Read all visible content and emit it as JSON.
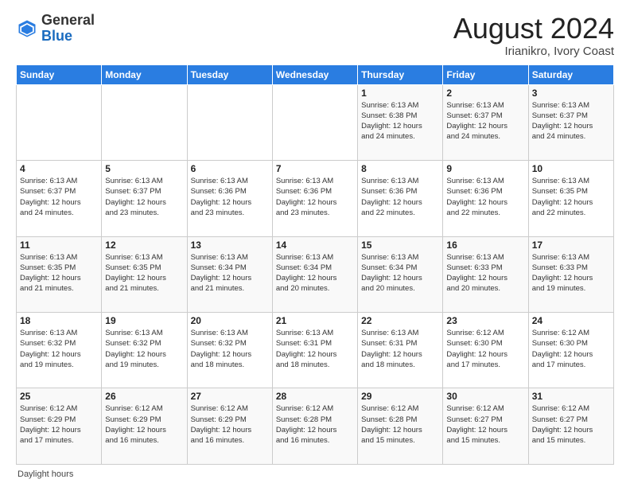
{
  "header": {
    "logo_general": "General",
    "logo_blue": "Blue",
    "main_title": "August 2024",
    "subtitle": "Irianikro, Ivory Coast"
  },
  "calendar": {
    "days_of_week": [
      "Sunday",
      "Monday",
      "Tuesday",
      "Wednesday",
      "Thursday",
      "Friday",
      "Saturday"
    ],
    "weeks": [
      [
        {
          "day": "",
          "info": ""
        },
        {
          "day": "",
          "info": ""
        },
        {
          "day": "",
          "info": ""
        },
        {
          "day": "",
          "info": ""
        },
        {
          "day": "1",
          "info": "Sunrise: 6:13 AM\nSunset: 6:38 PM\nDaylight: 12 hours\nand 24 minutes."
        },
        {
          "day": "2",
          "info": "Sunrise: 6:13 AM\nSunset: 6:37 PM\nDaylight: 12 hours\nand 24 minutes."
        },
        {
          "day": "3",
          "info": "Sunrise: 6:13 AM\nSunset: 6:37 PM\nDaylight: 12 hours\nand 24 minutes."
        }
      ],
      [
        {
          "day": "4",
          "info": "Sunrise: 6:13 AM\nSunset: 6:37 PM\nDaylight: 12 hours\nand 24 minutes."
        },
        {
          "day": "5",
          "info": "Sunrise: 6:13 AM\nSunset: 6:37 PM\nDaylight: 12 hours\nand 23 minutes."
        },
        {
          "day": "6",
          "info": "Sunrise: 6:13 AM\nSunset: 6:36 PM\nDaylight: 12 hours\nand 23 minutes."
        },
        {
          "day": "7",
          "info": "Sunrise: 6:13 AM\nSunset: 6:36 PM\nDaylight: 12 hours\nand 23 minutes."
        },
        {
          "day": "8",
          "info": "Sunrise: 6:13 AM\nSunset: 6:36 PM\nDaylight: 12 hours\nand 22 minutes."
        },
        {
          "day": "9",
          "info": "Sunrise: 6:13 AM\nSunset: 6:36 PM\nDaylight: 12 hours\nand 22 minutes."
        },
        {
          "day": "10",
          "info": "Sunrise: 6:13 AM\nSunset: 6:35 PM\nDaylight: 12 hours\nand 22 minutes."
        }
      ],
      [
        {
          "day": "11",
          "info": "Sunrise: 6:13 AM\nSunset: 6:35 PM\nDaylight: 12 hours\nand 21 minutes."
        },
        {
          "day": "12",
          "info": "Sunrise: 6:13 AM\nSunset: 6:35 PM\nDaylight: 12 hours\nand 21 minutes."
        },
        {
          "day": "13",
          "info": "Sunrise: 6:13 AM\nSunset: 6:34 PM\nDaylight: 12 hours\nand 21 minutes."
        },
        {
          "day": "14",
          "info": "Sunrise: 6:13 AM\nSunset: 6:34 PM\nDaylight: 12 hours\nand 20 minutes."
        },
        {
          "day": "15",
          "info": "Sunrise: 6:13 AM\nSunset: 6:34 PM\nDaylight: 12 hours\nand 20 minutes."
        },
        {
          "day": "16",
          "info": "Sunrise: 6:13 AM\nSunset: 6:33 PM\nDaylight: 12 hours\nand 20 minutes."
        },
        {
          "day": "17",
          "info": "Sunrise: 6:13 AM\nSunset: 6:33 PM\nDaylight: 12 hours\nand 19 minutes."
        }
      ],
      [
        {
          "day": "18",
          "info": "Sunrise: 6:13 AM\nSunset: 6:32 PM\nDaylight: 12 hours\nand 19 minutes."
        },
        {
          "day": "19",
          "info": "Sunrise: 6:13 AM\nSunset: 6:32 PM\nDaylight: 12 hours\nand 19 minutes."
        },
        {
          "day": "20",
          "info": "Sunrise: 6:13 AM\nSunset: 6:32 PM\nDaylight: 12 hours\nand 18 minutes."
        },
        {
          "day": "21",
          "info": "Sunrise: 6:13 AM\nSunset: 6:31 PM\nDaylight: 12 hours\nand 18 minutes."
        },
        {
          "day": "22",
          "info": "Sunrise: 6:13 AM\nSunset: 6:31 PM\nDaylight: 12 hours\nand 18 minutes."
        },
        {
          "day": "23",
          "info": "Sunrise: 6:12 AM\nSunset: 6:30 PM\nDaylight: 12 hours\nand 17 minutes."
        },
        {
          "day": "24",
          "info": "Sunrise: 6:12 AM\nSunset: 6:30 PM\nDaylight: 12 hours\nand 17 minutes."
        }
      ],
      [
        {
          "day": "25",
          "info": "Sunrise: 6:12 AM\nSunset: 6:29 PM\nDaylight: 12 hours\nand 17 minutes."
        },
        {
          "day": "26",
          "info": "Sunrise: 6:12 AM\nSunset: 6:29 PM\nDaylight: 12 hours\nand 16 minutes."
        },
        {
          "day": "27",
          "info": "Sunrise: 6:12 AM\nSunset: 6:29 PM\nDaylight: 12 hours\nand 16 minutes."
        },
        {
          "day": "28",
          "info": "Sunrise: 6:12 AM\nSunset: 6:28 PM\nDaylight: 12 hours\nand 16 minutes."
        },
        {
          "day": "29",
          "info": "Sunrise: 6:12 AM\nSunset: 6:28 PM\nDaylight: 12 hours\nand 15 minutes."
        },
        {
          "day": "30",
          "info": "Sunrise: 6:12 AM\nSunset: 6:27 PM\nDaylight: 12 hours\nand 15 minutes."
        },
        {
          "day": "31",
          "info": "Sunrise: 6:12 AM\nSunset: 6:27 PM\nDaylight: 12 hours\nand 15 minutes."
        }
      ]
    ]
  },
  "footer": {
    "note": "Daylight hours"
  }
}
